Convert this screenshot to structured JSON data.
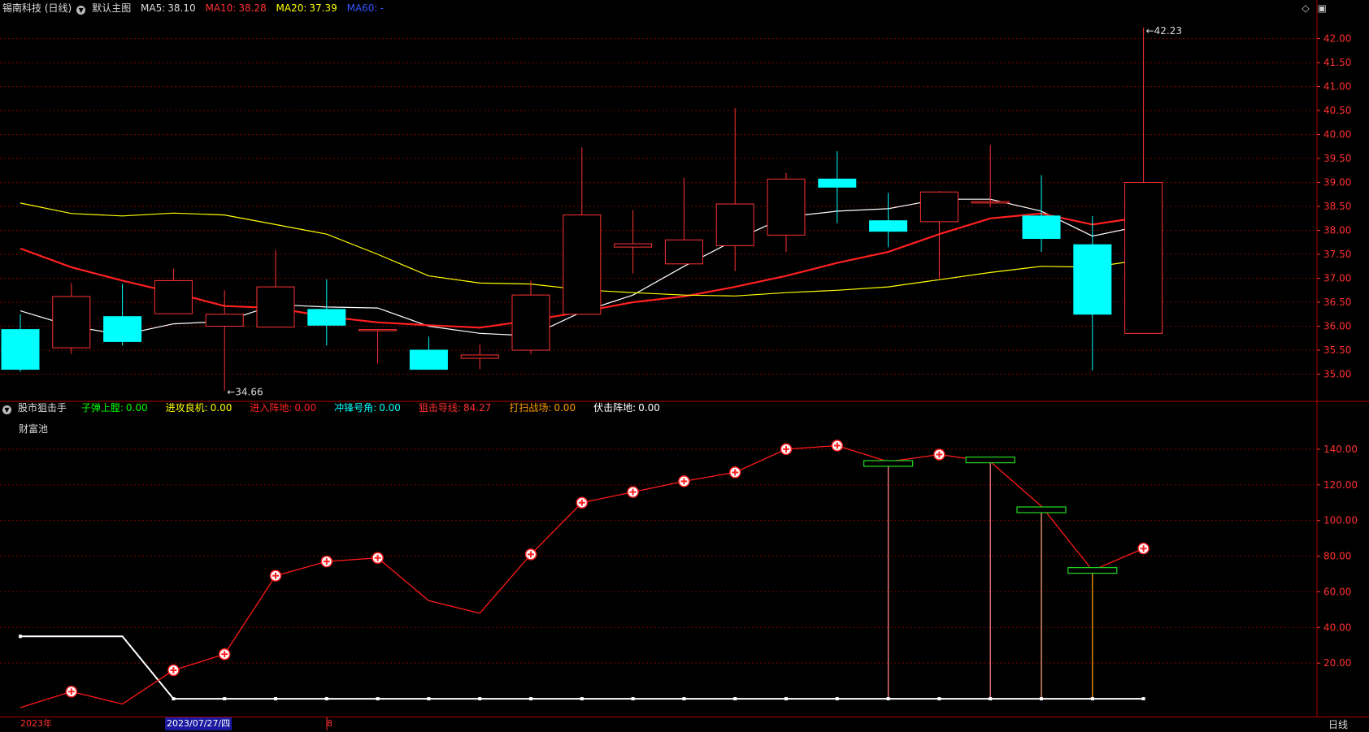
{
  "header": {
    "title": "锡南科技 (日线)",
    "chart_template": "默认主图",
    "ma5_label": "MA5:",
    "ma5_value": "38.10",
    "ma10_label": "MA10:",
    "ma10_value": "38.28",
    "ma20_label": "MA20:",
    "ma20_value": "37.39",
    "ma60_label": "MA60:",
    "ma60_value": "-"
  },
  "indicator_header": {
    "name": "股市狙击手",
    "items": [
      {
        "label": "子弹上膛:",
        "value": "0.00",
        "color": "#00ff00"
      },
      {
        "label": "进攻良机:",
        "value": "0.00",
        "color": "#ffff00"
      },
      {
        "label": "进入阵地:",
        "value": "0.00",
        "color": "#ff2020"
      },
      {
        "label": "冲锋号角:",
        "value": "0.00",
        "color": "#00ffff"
      },
      {
        "label": "狙击导线:",
        "value": "84.27",
        "color": "#ff3030"
      },
      {
        "label": "打扫战场:",
        "value": "0.00",
        "color": "#ff9900"
      },
      {
        "label": "伏击阵地:",
        "value": "0.00",
        "color": "#ffffff"
      }
    ],
    "sub_label": "财富池"
  },
  "bottom": {
    "year_label": "2023年",
    "cursor_date": "2023/07/27/四",
    "month_label": "8",
    "period_tab": "日线"
  },
  "colors": {
    "up": "#ff3232",
    "down": "#00ffff",
    "ma5": "#ffffff",
    "ma10": "#ff2020",
    "ma20": "#ffff00",
    "ma60": "#0000ff",
    "grid": "#7a0000",
    "axis": "#ff3030"
  },
  "icons": [
    "triangle-down-icon",
    "diamond-icon",
    "restore-icon"
  ],
  "chart_data": [
    {
      "type": "candlestick",
      "title": "锡南科技 (日线)",
      "ylim": [
        34.5,
        42.5
      ],
      "yticks": [
        "35.00",
        "35.50",
        "36.00",
        "36.50",
        "37.00",
        "37.50",
        "38.00",
        "38.50",
        "39.00",
        "39.50",
        "40.00",
        "40.50",
        "41.00",
        "41.50",
        "42.00"
      ],
      "candles": [
        {
          "open": 35.93,
          "close": 35.1,
          "high": 36.25,
          "low": 35.05
        },
        {
          "open": 35.55,
          "close": 36.62,
          "high": 36.9,
          "low": 35.42
        },
        {
          "open": 36.2,
          "close": 35.68,
          "high": 36.88,
          "low": 35.6
        },
        {
          "open": 36.26,
          "close": 36.95,
          "high": 37.2,
          "low": 36.26
        },
        {
          "open": 36.0,
          "close": 36.25,
          "high": 36.75,
          "low": 34.66
        },
        {
          "open": 35.98,
          "close": 36.82,
          "high": 37.58,
          "low": 35.98
        },
        {
          "open": 36.35,
          "close": 36.02,
          "high": 36.98,
          "low": 35.6
        },
        {
          "open": 35.93,
          "close": 35.93,
          "high": 35.93,
          "low": 35.22
        },
        {
          "open": 35.5,
          "close": 35.1,
          "high": 35.78,
          "low": 35.1
        },
        {
          "open": 35.33,
          "close": 35.4,
          "high": 35.62,
          "low": 35.1
        },
        {
          "open": 35.5,
          "close": 36.65,
          "high": 36.95,
          "low": 35.42
        },
        {
          "open": 36.25,
          "close": 38.32,
          "high": 39.73,
          "low": 36.25
        },
        {
          "open": 37.65,
          "close": 37.72,
          "high": 38.42,
          "low": 37.1
        },
        {
          "open": 37.3,
          "close": 37.8,
          "high": 39.1,
          "low": 37.3
        },
        {
          "open": 37.68,
          "close": 38.55,
          "high": 40.55,
          "low": 37.15
        },
        {
          "open": 37.9,
          "close": 39.07,
          "high": 39.2,
          "low": 37.55
        },
        {
          "open": 39.07,
          "close": 38.9,
          "high": 39.65,
          "low": 38.15
        },
        {
          "open": 38.2,
          "close": 37.98,
          "high": 38.78,
          "low": 37.65
        },
        {
          "open": 38.18,
          "close": 38.8,
          "high": 38.82,
          "low": 37.0
        },
        {
          "open": 38.57,
          "close": 38.6,
          "high": 39.78,
          "low": 38.48
        },
        {
          "open": 38.3,
          "close": 37.83,
          "high": 39.15,
          "low": 37.55
        },
        {
          "open": 37.7,
          "close": 36.25,
          "high": 38.3,
          "low": 35.08
        },
        {
          "open": 35.85,
          "close": 39.0,
          "high": 42.23,
          "low": 35.85
        }
      ],
      "series": [
        {
          "name": "MA5",
          "values": [
            36.32,
            36.0,
            35.82,
            36.05,
            36.1,
            36.45,
            36.4,
            36.38,
            36.0,
            35.85,
            35.8,
            36.3,
            36.65,
            37.25,
            37.8,
            38.28,
            38.4,
            38.45,
            38.65,
            38.65,
            38.4,
            37.88,
            38.1
          ]
        },
        {
          "name": "MA10",
          "values": [
            37.62,
            37.23,
            36.95,
            36.7,
            36.42,
            36.38,
            36.2,
            36.08,
            36.02,
            35.97,
            36.12,
            36.3,
            36.5,
            36.62,
            36.82,
            37.05,
            37.32,
            37.55,
            37.92,
            38.25,
            38.35,
            38.12,
            38.28
          ]
        },
        {
          "name": "MA20",
          "values": [
            38.57,
            38.35,
            38.3,
            38.36,
            38.32,
            38.12,
            37.92,
            37.5,
            37.05,
            36.9,
            36.88,
            36.76,
            36.7,
            36.65,
            36.63,
            36.7,
            36.75,
            36.82,
            36.97,
            37.12,
            37.25,
            37.23,
            37.39
          ]
        },
        {
          "name": "MA60",
          "values": []
        }
      ],
      "annotations": [
        {
          "text": "34.66",
          "candle": 4
        },
        {
          "text": "42.23",
          "candle": 22
        }
      ]
    },
    {
      "type": "line",
      "title": "股市狙击手",
      "ylim": [
        -10,
        155
      ],
      "yticks": [
        "20.00",
        "40.00",
        "60.00",
        "80.00",
        "100.00",
        "120.00",
        "140.00"
      ],
      "series": [
        {
          "name": "狙击导线",
          "values": [
            -5,
            4,
            -3,
            16,
            25,
            69,
            77,
            79,
            55,
            48,
            81,
            110,
            116,
            122,
            127,
            140,
            142,
            133,
            137,
            133,
            108,
            72,
            84.27
          ]
        },
        {
          "name": "伏击阵地",
          "values": [
            35,
            35,
            35,
            0,
            0,
            0,
            0,
            0,
            0,
            0,
            0,
            0,
            0,
            0,
            0,
            0,
            0,
            0,
            0,
            0,
            0,
            0,
            0
          ]
        }
      ],
      "buy_markers": [
        1,
        3,
        4,
        5,
        6,
        7,
        10,
        11,
        12,
        13,
        14,
        15,
        16,
        18,
        22
      ],
      "boxes": [
        {
          "candle": 17,
          "value": 132
        },
        {
          "candle": 19,
          "value": 134
        },
        {
          "candle": 20,
          "value": 106
        },
        {
          "candle": 21,
          "value": 72
        }
      ],
      "stems": [
        {
          "candle": 17,
          "top": 132,
          "color": "#ff8080"
        },
        {
          "candle": 19,
          "top": 134,
          "color": "#ff8080"
        },
        {
          "candle": 20,
          "top": 106,
          "color": "#ffa070"
        },
        {
          "candle": 21,
          "top": 72,
          "color": "#ff9900"
        }
      ]
    }
  ]
}
